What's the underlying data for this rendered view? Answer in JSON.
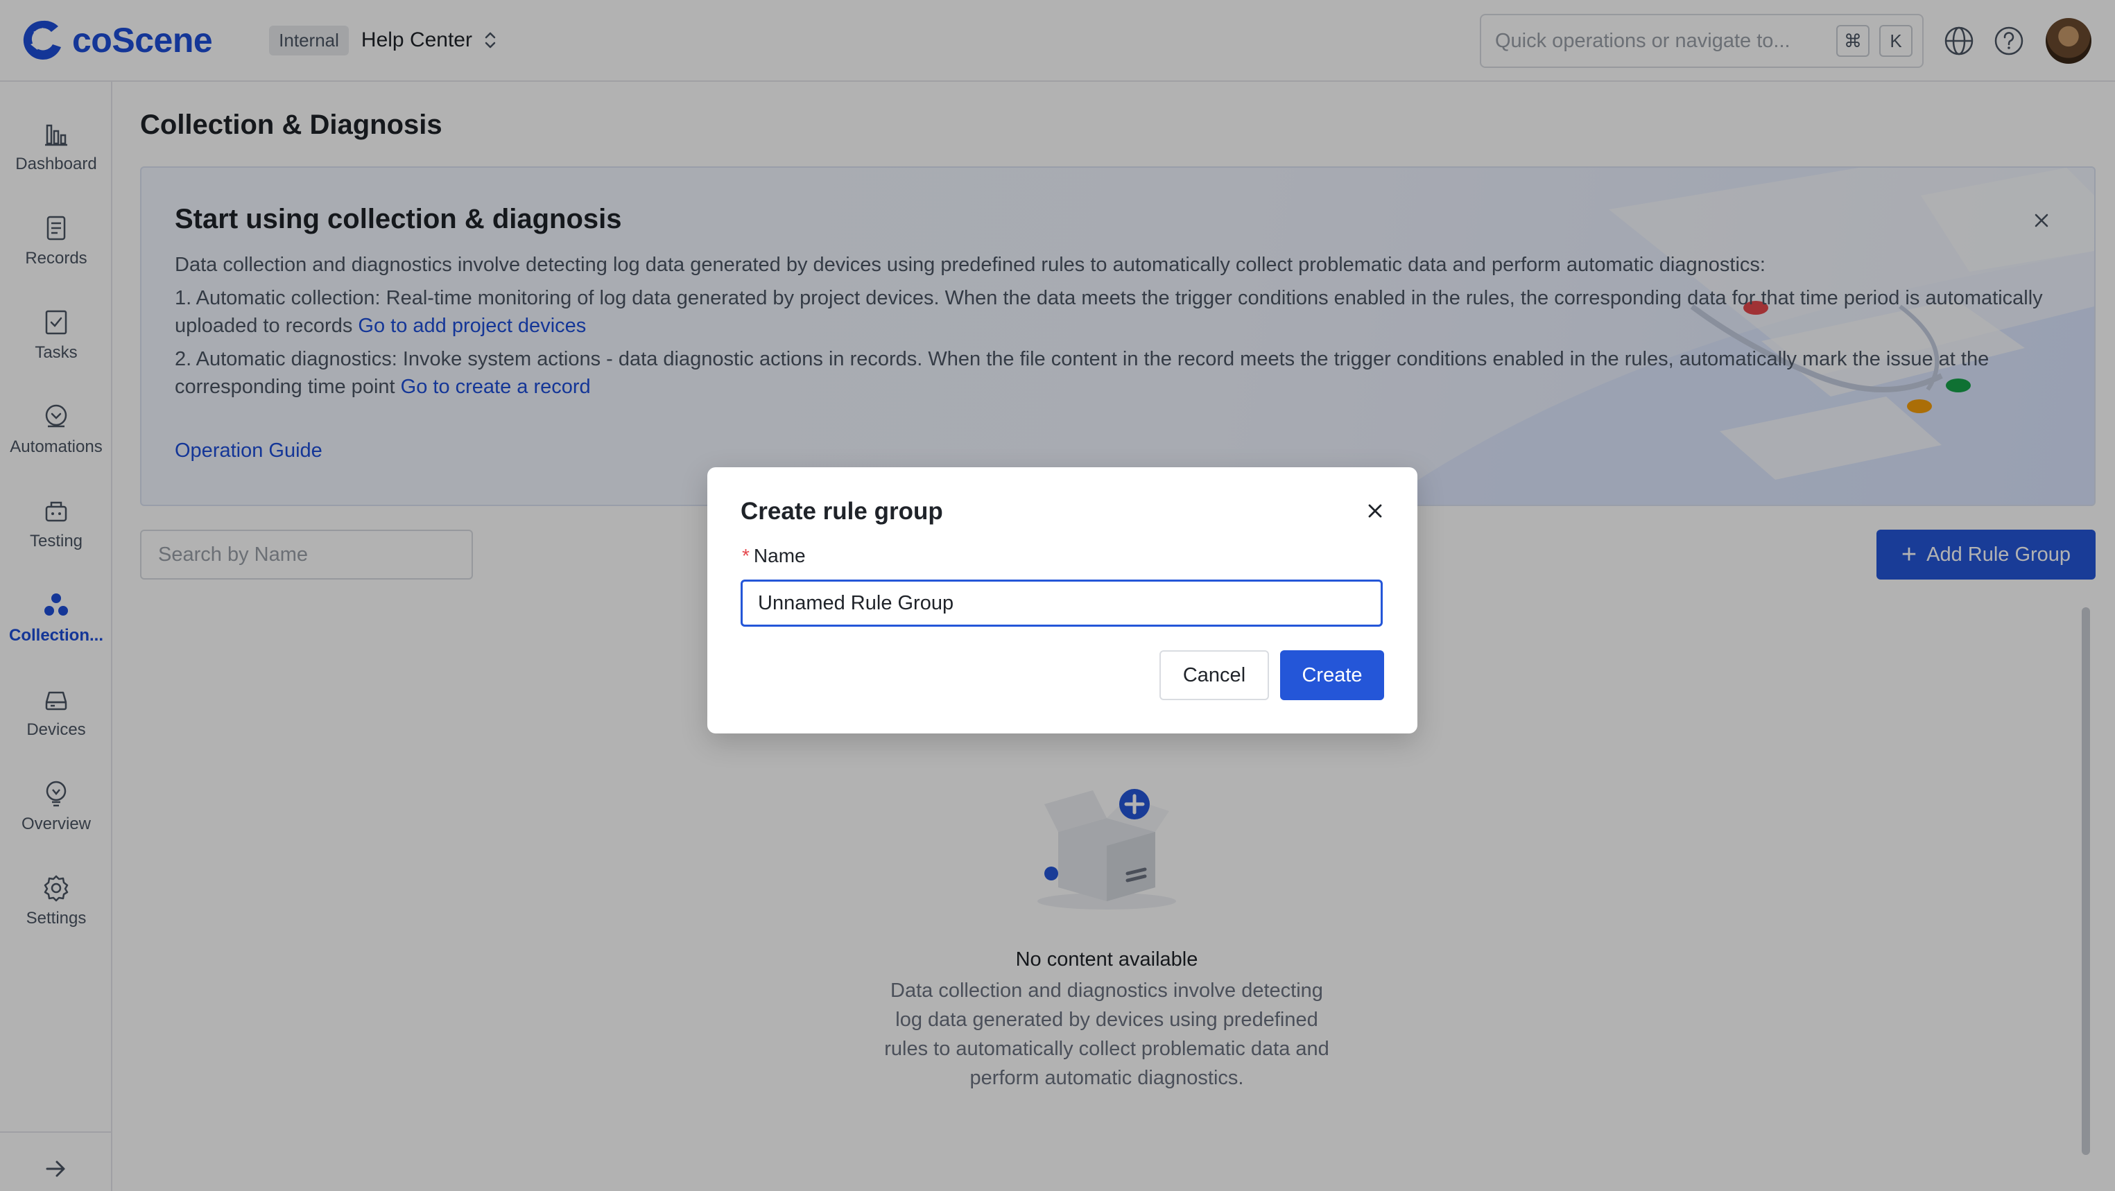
{
  "app": {
    "name": "coScene"
  },
  "header": {
    "org_badge": "Internal",
    "project_name": "Help Center",
    "quick_search_placeholder": "Quick operations or navigate to...",
    "shortcut_keys": [
      "⌘",
      "K"
    ],
    "icons": [
      "language-icon",
      "help-icon",
      "user-avatar"
    ]
  },
  "sidebar": {
    "items": [
      {
        "label": "Dashboard",
        "icon": "bar-chart-icon",
        "active": false
      },
      {
        "label": "Records",
        "icon": "records-icon",
        "active": false
      },
      {
        "label": "Tasks",
        "icon": "tasks-icon",
        "active": false
      },
      {
        "label": "Automations",
        "icon": "automations-icon",
        "active": false
      },
      {
        "label": "Testing",
        "icon": "testing-icon",
        "active": false
      },
      {
        "label": "Collection...",
        "icon": "collection-icon",
        "active": true
      },
      {
        "label": "Devices",
        "icon": "devices-icon",
        "active": false
      },
      {
        "label": "Overview",
        "icon": "overview-icon",
        "active": false
      },
      {
        "label": "Settings",
        "icon": "settings-icon",
        "active": false
      }
    ]
  },
  "main": {
    "title": "Collection & Diagnosis",
    "banner": {
      "title": "Start using collection & diagnosis",
      "intro": "Data collection and diagnostics involve detecting log data generated by devices using predefined rules to automatically collect problematic data and perform automatic diagnostics:",
      "item1_text": "1. Automatic collection: Real-time monitoring of log data generated by project devices. When the data meets the trigger conditions enabled in the rules, the corresponding data for that time period is automatically uploaded to records",
      "item1_link": "Go to add project devices",
      "item2_text": "2. Automatic diagnostics: Invoke system actions - data diagnostic actions in records. When the file content in the record meets the trigger conditions enabled in the rules, automatically mark the issue at the corresponding time point",
      "item2_link": "Go to create a record",
      "guide_link": "Operation Guide"
    },
    "search_placeholder": "Search by Name",
    "add_button": "Add Rule Group",
    "empty": {
      "title": "No content available",
      "description": "Data collection and diagnostics involve detecting log data generated by devices using predefined rules to automatically collect problematic data and perform automatic diagnostics."
    }
  },
  "modal": {
    "title": "Create rule group",
    "field_label": "Name",
    "required_mark": "*",
    "name_value": "Unnamed Rule Group",
    "cancel": "Cancel",
    "create": "Create"
  },
  "colors": {
    "primary": "#2456d8",
    "brand": "#1d4ed8",
    "required": "#e5484d"
  }
}
